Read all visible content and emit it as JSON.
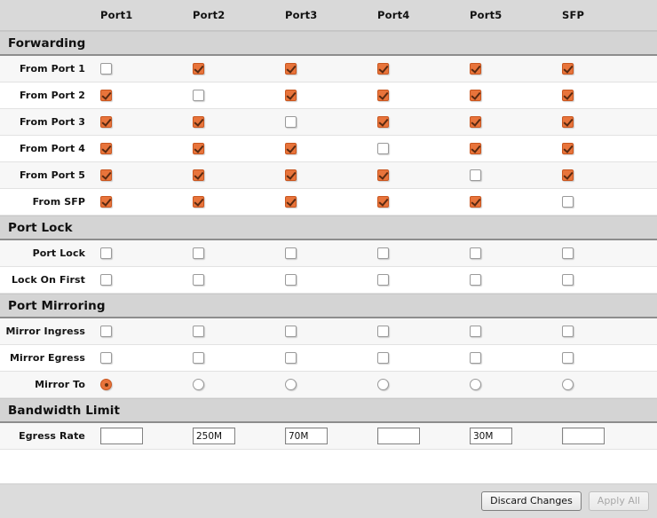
{
  "columns": [
    "Port1",
    "Port2",
    "Port3",
    "Port4",
    "Port5",
    "SFP"
  ],
  "colors": {
    "accent": "#e8743b",
    "accent_border": "#c9561f",
    "check_mark": "#5a2a11",
    "header_bg": "#d9d9d9",
    "section_bg": "#d4d4d4",
    "row_alt_bg": "#f7f7f7",
    "footer_bg": "#dcdcdc"
  },
  "sections": [
    {
      "title": "Forwarding",
      "control": "checkbox",
      "rows": [
        {
          "label": "From Port 1",
          "values": [
            false,
            true,
            true,
            true,
            true,
            true
          ]
        },
        {
          "label": "From Port 2",
          "values": [
            true,
            false,
            true,
            true,
            true,
            true
          ]
        },
        {
          "label": "From Port 3",
          "values": [
            true,
            true,
            false,
            true,
            true,
            true
          ]
        },
        {
          "label": "From Port 4",
          "values": [
            true,
            true,
            true,
            false,
            true,
            true
          ]
        },
        {
          "label": "From Port 5",
          "values": [
            true,
            true,
            true,
            true,
            false,
            true
          ]
        },
        {
          "label": "From SFP",
          "values": [
            true,
            true,
            true,
            true,
            true,
            false
          ]
        }
      ]
    },
    {
      "title": "Port Lock",
      "control": "checkbox",
      "rows": [
        {
          "label": "Port Lock",
          "values": [
            false,
            false,
            false,
            false,
            false,
            false
          ]
        },
        {
          "label": "Lock On First",
          "values": [
            false,
            false,
            false,
            false,
            false,
            false
          ]
        }
      ]
    },
    {
      "title": "Port Mirroring",
      "control": "mixed",
      "rows": [
        {
          "label": "Mirror Ingress",
          "control": "checkbox",
          "values": [
            false,
            false,
            false,
            false,
            false,
            false
          ]
        },
        {
          "label": "Mirror Egress",
          "control": "checkbox",
          "values": [
            false,
            false,
            false,
            false,
            false,
            false
          ]
        },
        {
          "label": "Mirror To",
          "control": "radio",
          "values": [
            true,
            false,
            false,
            false,
            false,
            false
          ]
        }
      ]
    },
    {
      "title": "Bandwidth Limit",
      "control": "text",
      "rows": [
        {
          "label": "Egress Rate",
          "values": [
            "",
            "250M",
            "70M",
            "",
            "30M",
            ""
          ]
        }
      ]
    }
  ],
  "footer": {
    "discard_label": "Discard Changes",
    "apply_label": "Apply All",
    "apply_disabled": true
  }
}
